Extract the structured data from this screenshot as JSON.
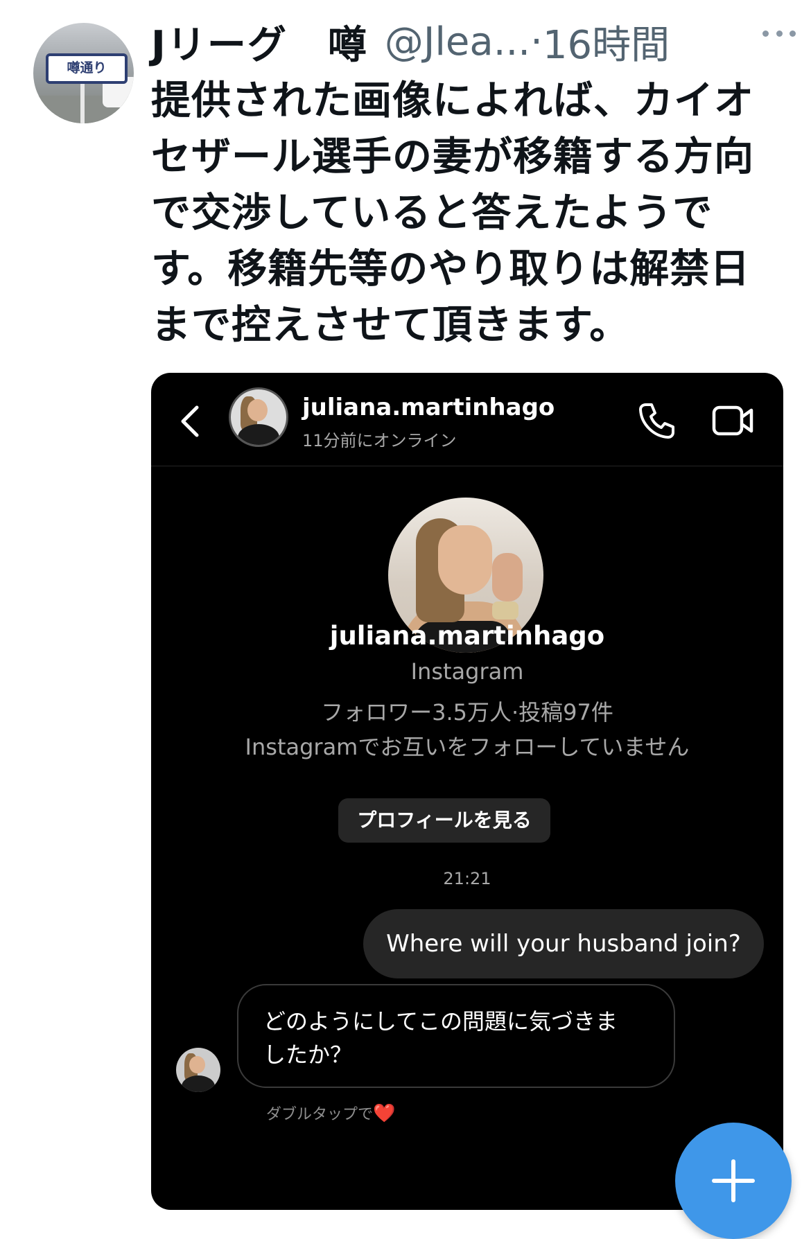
{
  "tweet": {
    "author_name": "Jリーグ　噂",
    "handle": "@Jlea...",
    "separator": "·",
    "time": "16時間",
    "avatar_sign_text": "噂通り",
    "text_lines": [
      "提供された画像によれば、カイオ",
      "セザール選手の妻が移籍する方向",
      "で交渉していると答えたようで",
      "す。移籍先等のやり取りは解禁日",
      "まで控えさせて頂きます。"
    ],
    "icons": {
      "more": "more-horizontal-icon",
      "compose": "plus-icon"
    },
    "colors": {
      "handle": "#536471",
      "fab": "#3f97e9"
    }
  },
  "dm": {
    "header": {
      "username": "juliana.martinhago",
      "status": "11分前にオンライン"
    },
    "profile": {
      "username": "juliana.martinhago",
      "source": "Instagram",
      "stats": "フォロワー3.5万人·投稿97件",
      "follow_status": "Instagramでお互いをフォローしていません",
      "view_profile_button": "プロフィールを見る"
    },
    "timestamp": "21:21",
    "messages": {
      "outgoing": "Where will your husband join?",
      "incoming_lines": [
        "どのようにしてこの問題に気づきま",
        "したか？"
      ]
    },
    "double_tap_hint": "ダブルタップで",
    "heart": "❤️",
    "icons": {
      "back": "chevron-left-icon",
      "call": "phone-icon",
      "video": "video-camera-icon"
    }
  }
}
